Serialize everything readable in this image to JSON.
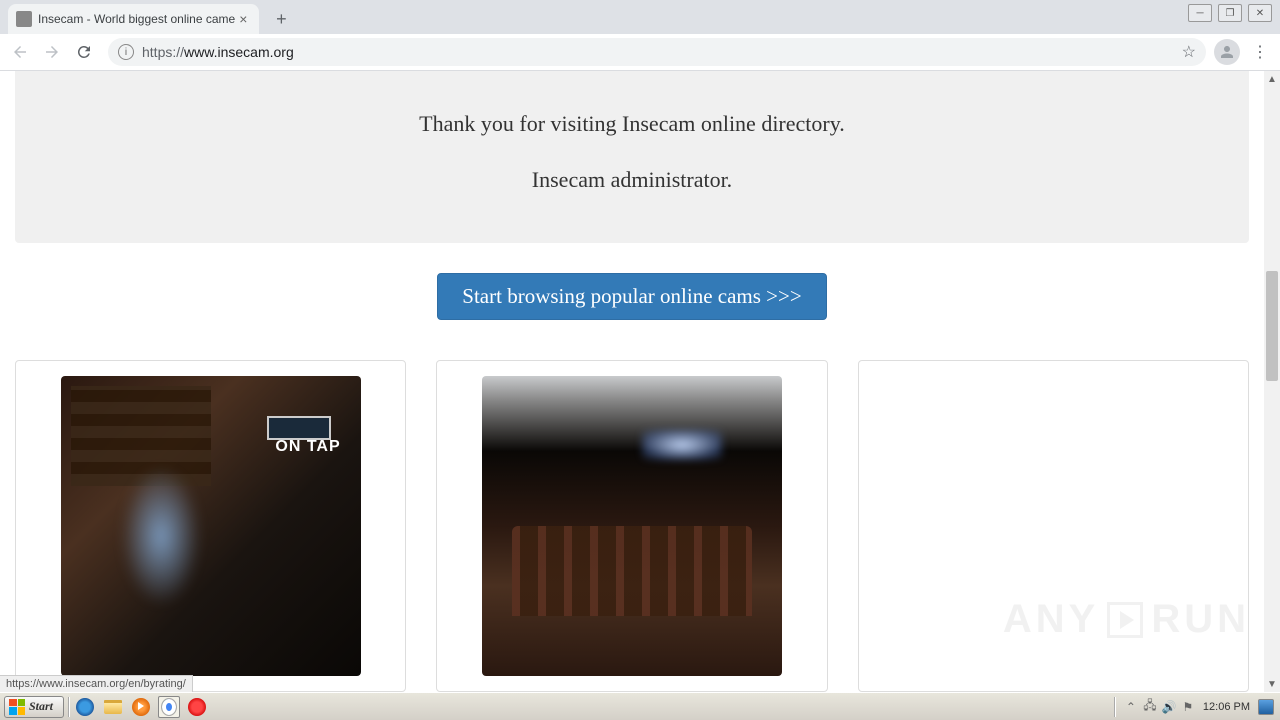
{
  "browser": {
    "tab_title": "Insecam - World biggest online came",
    "url_proto": "https://",
    "url_host": "www.insecam.org",
    "status_link": "https://www.insecam.org/en/byrating/"
  },
  "page": {
    "thank_you": "Thank you for visiting Insecam online directory.",
    "signature": "Insecam administrator.",
    "start_button": "Start browsing popular online cams >>>",
    "cam1_sign": "ON TAP"
  },
  "taskbar": {
    "start_label": "Start",
    "clock": "12:06 PM"
  },
  "watermark": {
    "left": "ANY",
    "right": "RUN"
  }
}
